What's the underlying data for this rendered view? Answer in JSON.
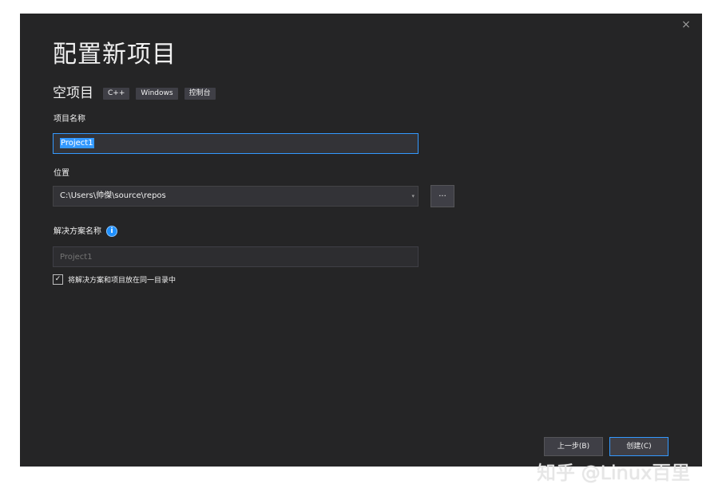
{
  "dialog": {
    "close_glyph": "×",
    "title": "配置新项目",
    "template": {
      "name": "空项目",
      "tags": [
        "C++",
        "Windows",
        "控制台"
      ]
    }
  },
  "project_name": {
    "label": "项目名称",
    "value": "Project1"
  },
  "location": {
    "label": "位置",
    "value": "C:\\Users\\帅傑\\source\\repos",
    "dropdown_glyph": "▾",
    "browse_label": "..."
  },
  "solution_name": {
    "label": "解决方案名称",
    "info_glyph": "i",
    "placeholder": "Project1"
  },
  "same_directory": {
    "checked": true,
    "check_glyph": "✓",
    "label": "将解决方案和项目放在同一目录中"
  },
  "footer": {
    "back_label": "上一步(B)",
    "create_label": "创建(C)"
  },
  "watermark": "知乎 @Linux百里",
  "colors": {
    "dialog_bg": "#252526",
    "input_bg": "#333337",
    "accent": "#3399ff"
  }
}
